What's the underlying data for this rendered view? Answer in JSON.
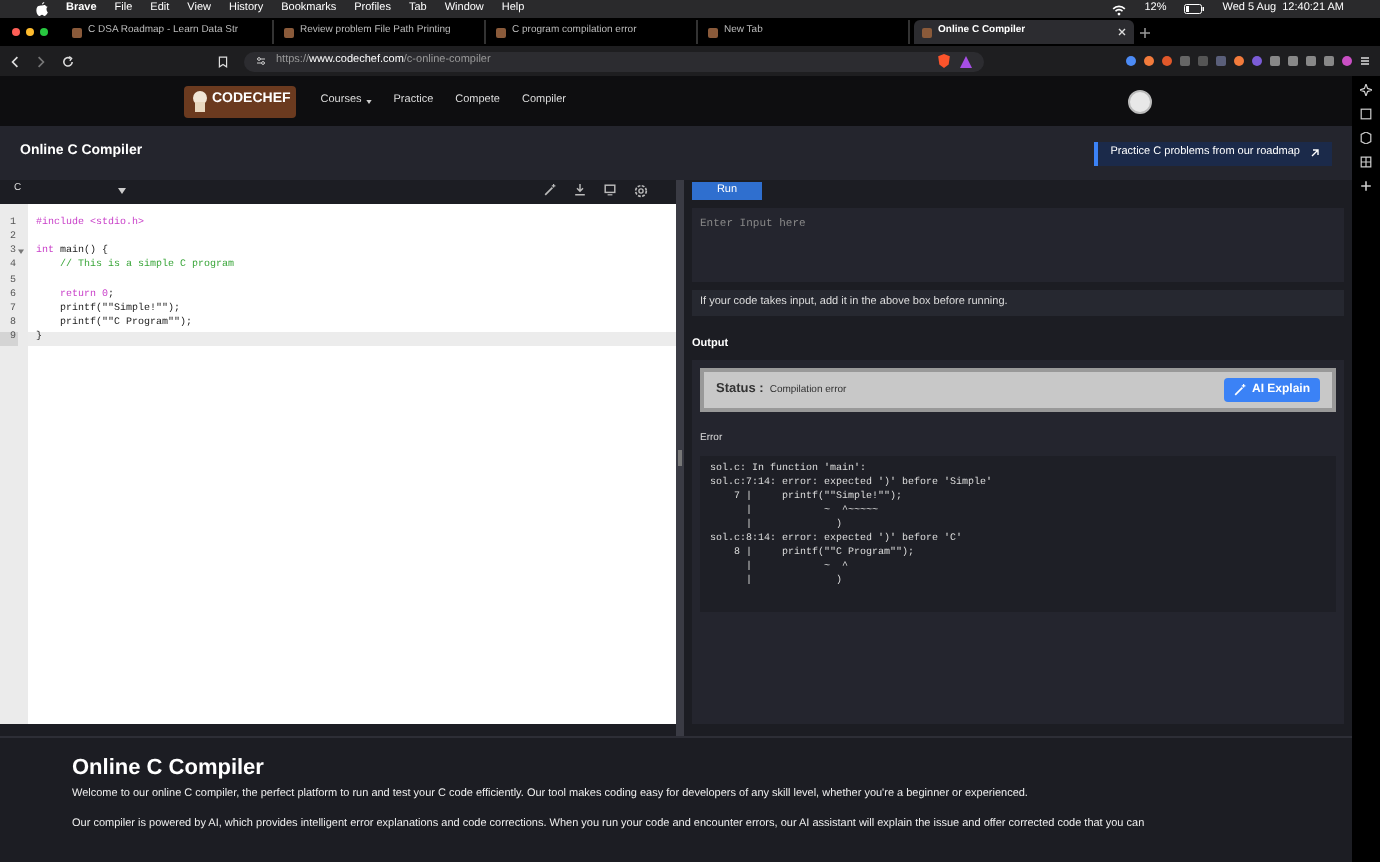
{
  "menu_bar": {
    "app": "Brave",
    "items": [
      "File",
      "Edit",
      "View",
      "History",
      "Bookmarks",
      "Profiles",
      "Tab",
      "Window",
      "Help"
    ],
    "battery": "12%",
    "clock": "Wed 5 Aug  12:40:21 AM"
  },
  "tabs": [
    {
      "title": "C DSA Roadmap - Learn Data Str",
      "selected": false
    },
    {
      "title": "Review problem File Path Printing",
      "selected": false
    },
    {
      "title": "C program compilation error",
      "selected": false
    },
    {
      "title": "New Tab",
      "selected": false
    },
    {
      "title": "Online C Compiler",
      "selected": true
    }
  ],
  "address_bar": {
    "url_prefix": "https://",
    "url_host": "www.codechef.com",
    "url_path": "/c-online-compiler"
  },
  "site_nav": {
    "logo": "CODECHEF",
    "links": [
      {
        "label": "Courses",
        "dropdown": true
      },
      {
        "label": "Practice",
        "dropdown": false
      },
      {
        "label": "Compete",
        "dropdown": false
      },
      {
        "label": "Compiler",
        "dropdown": false
      }
    ]
  },
  "page_header": {
    "title": "Online C Compiler",
    "roadmap_button": "Practice C problems from our roadmap"
  },
  "editor": {
    "language": "C",
    "lines": [
      {
        "number": "1",
        "fold": false,
        "current": false,
        "tokens": [
          {
            "kind": "directive",
            "text": "#include <stdio.h>"
          }
        ]
      },
      {
        "number": "2",
        "fold": false,
        "current": false
      },
      {
        "number": "3",
        "fold": true,
        "current": false,
        "tokens": [
          {
            "kind": "keyword",
            "text": "int"
          },
          {
            "kind": "plain",
            "text": " main() {"
          }
        ]
      },
      {
        "number": "4",
        "fold": false,
        "current": false,
        "tokens": [
          {
            "kind": "comment",
            "text": "    // This is a simple C program"
          }
        ]
      },
      {
        "number": "5",
        "fold": false,
        "current": false
      },
      {
        "number": "6",
        "fold": false,
        "current": false,
        "tokens": [
          {
            "kind": "keyword",
            "text": "    return 0"
          },
          {
            "kind": "plain",
            "text": ";"
          }
        ]
      },
      {
        "number": "7",
        "fold": false,
        "current": false,
        "tokens": [
          {
            "kind": "plain",
            "text": "    printf(\"\"Simple!\"\");"
          }
        ]
      },
      {
        "number": "8",
        "fold": false,
        "current": false,
        "tokens": [
          {
            "kind": "plain",
            "text": "    printf(\"\"C Program\"\");"
          }
        ]
      },
      {
        "number": "9",
        "fold": false,
        "current": true,
        "tokens": [
          {
            "kind": "plain",
            "text": "}"
          }
        ]
      }
    ]
  },
  "run_panel": {
    "run_button": "Run",
    "input": {
      "placeholder": "Enter Input here"
    },
    "hint": "If your code takes input, add it in the above box before running.",
    "output_label": "Output",
    "status_label": "Status :",
    "status_value": "Compilation error",
    "ai_button": "AI Explain",
    "error_label": "Error",
    "error_lines": [
      "sol.c: In function 'main':",
      "sol.c:7:14: error: expected ')' before 'Simple'",
      "    7 |     printf(\"\"Simple!\"\");",
      "      |            ~  ^~~~~~",
      "      |              )",
      "sol.c:8:14: error: expected ')' before 'C'",
      "    8 |     printf(\"\"C Program\"\");",
      "      |            ~  ^",
      "      |              )"
    ]
  },
  "about": {
    "title": "Online C Compiler",
    "paragraphs": [
      "Welcome to our online C compiler, the perfect platform to run and test your C code efficiently. Our tool makes coding easy for developers of any skill level, whether you're a beginner or experienced.",
      "Our compiler is powered by AI, which provides intelligent error explanations and code corrections. When you run your code and encounter errors, our AI assistant will explain the issue and offer corrected code that you can"
    ]
  }
}
